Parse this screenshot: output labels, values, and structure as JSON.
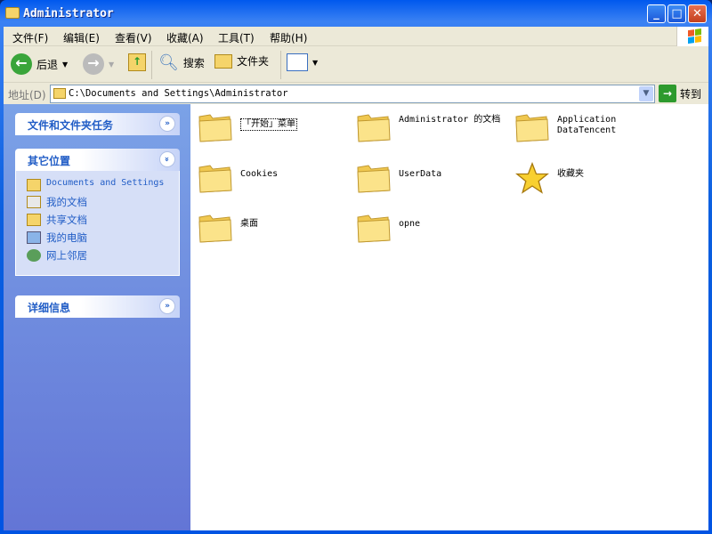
{
  "window": {
    "title": "Administrator"
  },
  "menu": [
    "文件(F)",
    "编辑(E)",
    "查看(V)",
    "收藏(A)",
    "工具(T)",
    "帮助(H)"
  ],
  "toolbar": {
    "back": "后退",
    "search": "搜索",
    "folders": "文件夹"
  },
  "address": {
    "label": "地址(D)",
    "value": "C:\\Documents and Settings\\Administrator",
    "go": "转到"
  },
  "sidebar": {
    "tasks": {
      "title": "文件和文件夹任务"
    },
    "places": {
      "title": "其它位置",
      "items": [
        "Documents and Settings",
        "我的文档",
        "共享文档",
        "我的电脑",
        "网上邻居"
      ]
    },
    "details": {
      "title": "详细信息"
    }
  },
  "items": [
    {
      "label": "「开始」菜单",
      "icon": "folder-icon"
    },
    {
      "label": "Administrator 的文档",
      "icon": "folder-icon"
    },
    {
      "label": "Application DataTencent",
      "icon": "folder-icon"
    },
    {
      "label": "Cookies",
      "icon": "folder-icon"
    },
    {
      "label": "UserData",
      "icon": "folder-icon"
    },
    {
      "label": "收藏夹",
      "icon": "star-icon"
    },
    {
      "label": "桌面",
      "icon": "folder-icon"
    },
    {
      "label": "opne",
      "icon": "folder-icon"
    }
  ]
}
